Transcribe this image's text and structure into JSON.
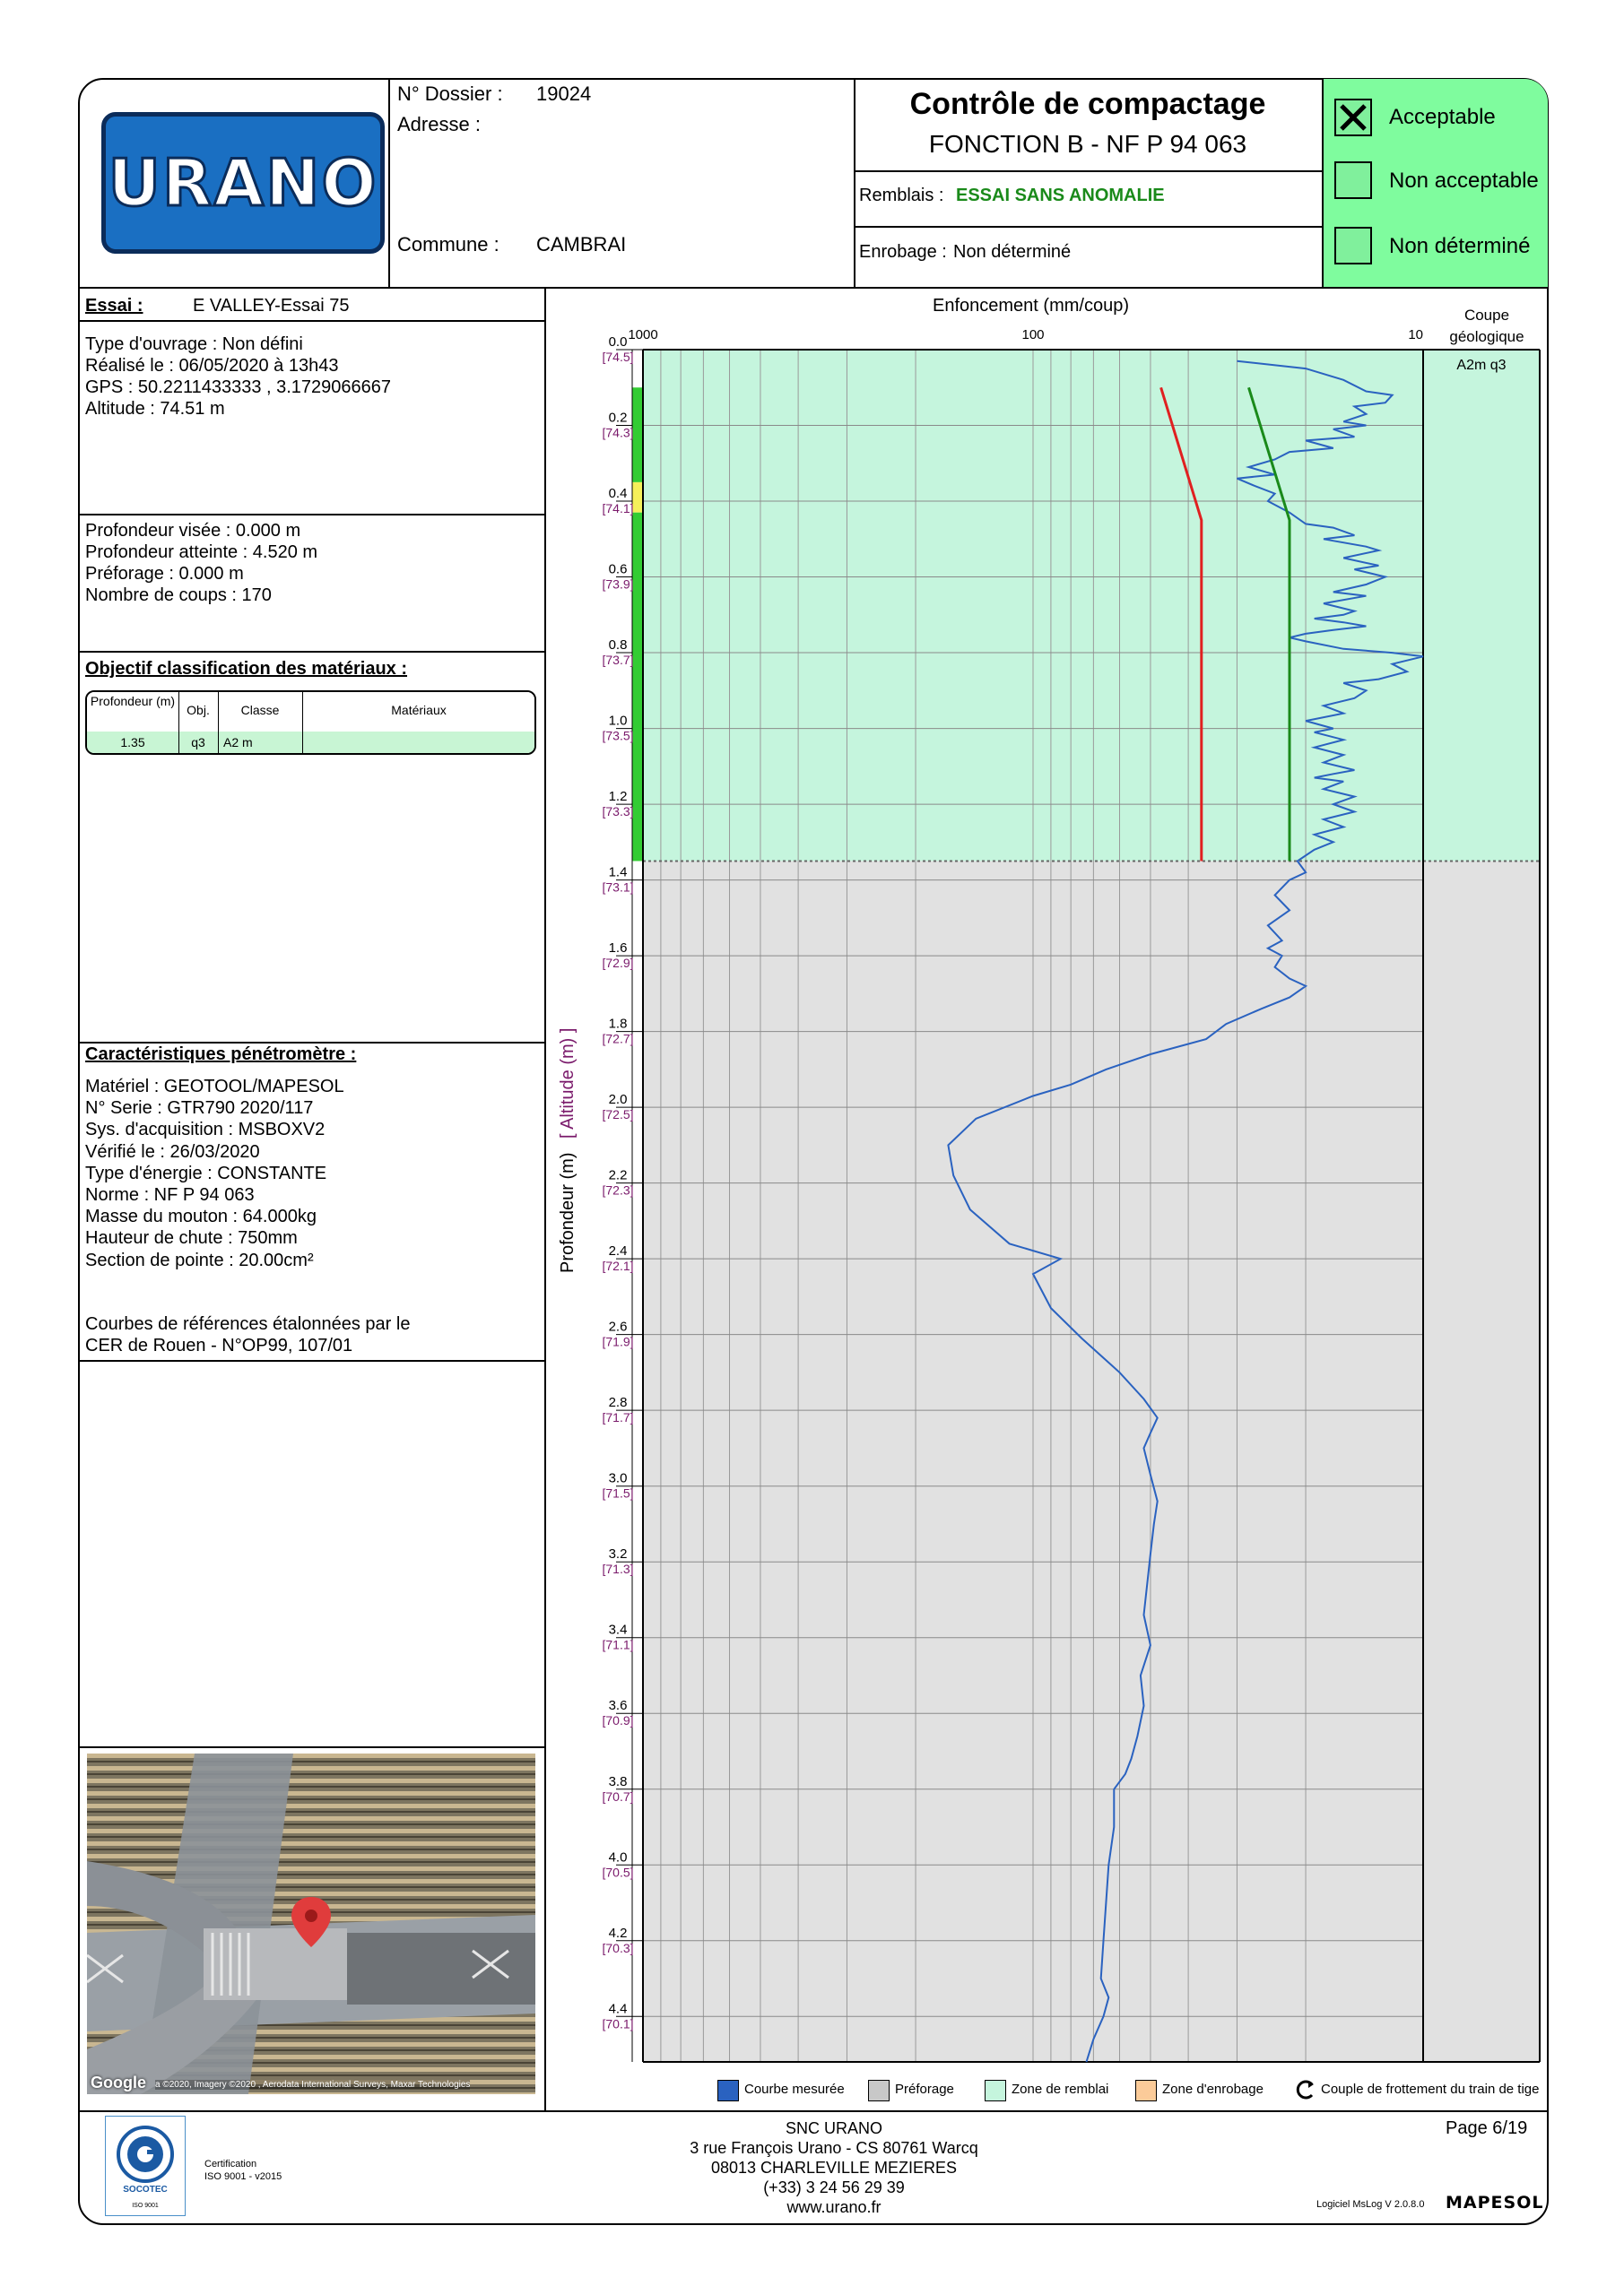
{
  "header": {
    "logo_text": "URANO",
    "dossier_label": "N° Dossier :",
    "dossier_value": "19024",
    "adresse_label": "Adresse :",
    "commune_label": "Commune :",
    "commune_value": "CAMBRAI",
    "title": "Contrôle de compactage",
    "subtitle": "FONCTION B - NF P 94 063",
    "remblais_label": "Remblais :",
    "remblais_value": "ESSAI SANS ANOMALIE",
    "enrobage_label": "Enrobage :",
    "enrobage_value": "Non déterminé",
    "status": [
      {
        "label": "Acceptable",
        "checked": true
      },
      {
        "label": "Non acceptable",
        "checked": false
      },
      {
        "label": "Non déterminé",
        "checked": false
      }
    ],
    "status_color": "#7ffc9e"
  },
  "essai": {
    "label": "Essai :",
    "value": "E VALLEY-Essai 75",
    "info": [
      "Type d'ouvrage : Non défini",
      "Réalisé le  : 06/05/2020  à 13h43",
      "GPS : 50.2211433333 , 3.1729066667",
      "Altitude : 74.51 m"
    ],
    "profondeur": [
      "Profondeur visée : 0.000 m",
      "Profondeur atteinte : 4.520 m",
      "Préforage : 0.000 m",
      "Nombre de coups : 170"
    ]
  },
  "objectif": {
    "title": "Objectif classification des matériaux :",
    "columns": [
      "Profondeur (m)",
      "Obj.",
      "Classe",
      "Matériaux"
    ],
    "rows": [
      [
        "1.35",
        "q3",
        "A2 m",
        ""
      ]
    ]
  },
  "penetrometre": {
    "title": "Caractéristiques pénétromètre :",
    "lines": [
      "Matériel : GEOTOOL/MAPESOL",
      "N° Serie : GTR790 2020/117",
      "Sys. d'acquisition : MSBOXV2",
      "Vérifié le : 26/03/2020",
      "Type d'énergie : CONSTANTE",
      "Norme : NF P 94 063",
      "Masse du mouton : 64.000kg",
      "Hauteur de chute : 750mm",
      "Section de pointe : 20.00cm²"
    ],
    "reference": [
      "Courbes de références étalonnées par le",
      "CER de Rouen - N°OP99, 107/01"
    ]
  },
  "map": {
    "google_label": "Google",
    "credit": "a ©2020, Imagery ©2020 , Aerodata International Surveys, Maxar Technologies"
  },
  "chart_data": {
    "type": "line",
    "title": "Enfoncement (mm/coup)",
    "ylabel": "Profondeur (m)",
    "ylabel2": "[ Altitude (m) ]",
    "xscale": "log",
    "xlim": [
      1000,
      10
    ],
    "xticks": [
      "1000",
      "100",
      "10"
    ],
    "ylim": [
      0,
      4.52
    ],
    "yticks": [
      {
        "depth": "0.0",
        "alt": "[74.5]"
      },
      {
        "depth": "0.2",
        "alt": "[74.3]"
      },
      {
        "depth": "0.4",
        "alt": "[74.1]"
      },
      {
        "depth": "0.6",
        "alt": "[73.9]"
      },
      {
        "depth": "0.8",
        "alt": "[73.7]"
      },
      {
        "depth": "1.0",
        "alt": "[73.5]"
      },
      {
        "depth": "1.2",
        "alt": "[73.3]"
      },
      {
        "depth": "1.4",
        "alt": "[73.1]"
      },
      {
        "depth": "1.6",
        "alt": "[72.9]"
      },
      {
        "depth": "1.8",
        "alt": "[72.7]"
      },
      {
        "depth": "2.0",
        "alt": "[72.5]"
      },
      {
        "depth": "2.2",
        "alt": "[72.3]"
      },
      {
        "depth": "2.4",
        "alt": "[72.1]"
      },
      {
        "depth": "2.6",
        "alt": "[71.9]"
      },
      {
        "depth": "2.8",
        "alt": "[71.7]"
      },
      {
        "depth": "3.0",
        "alt": "[71.5]"
      },
      {
        "depth": "3.2",
        "alt": "[71.3]"
      },
      {
        "depth": "3.4",
        "alt": "[71.1]"
      },
      {
        "depth": "3.6",
        "alt": "[70.9]"
      },
      {
        "depth": "3.8",
        "alt": "[70.7]"
      },
      {
        "depth": "4.0",
        "alt": "[70.5]"
      },
      {
        "depth": "4.2",
        "alt": "[70.3]"
      },
      {
        "depth": "4.4",
        "alt": "[70.1]"
      }
    ],
    "remblai_depth": 1.35,
    "geo_column_label": "Coupe géologique",
    "geo_layer": "A2m q3",
    "series": [
      {
        "name": "Courbe mesurée",
        "color": "#2a62c0",
        "points": [
          [
            30,
            0.03
          ],
          [
            20,
            0.05
          ],
          [
            16,
            0.08
          ],
          [
            14,
            0.11
          ],
          [
            12,
            0.12
          ],
          [
            12.5,
            0.14
          ],
          [
            15,
            0.15
          ],
          [
            14,
            0.17
          ],
          [
            16,
            0.19
          ],
          [
            14,
            0.2
          ],
          [
            17,
            0.21
          ],
          [
            15,
            0.23
          ],
          [
            20,
            0.24
          ],
          [
            17,
            0.26
          ],
          [
            22,
            0.27
          ],
          [
            24,
            0.29
          ],
          [
            28,
            0.31
          ],
          [
            24,
            0.33
          ],
          [
            30,
            0.34
          ],
          [
            27,
            0.36
          ],
          [
            24,
            0.38
          ],
          [
            25,
            0.4
          ],
          [
            22,
            0.43
          ],
          [
            20,
            0.46
          ],
          [
            17,
            0.47
          ],
          [
            15,
            0.49
          ],
          [
            18,
            0.5
          ],
          [
            14,
            0.52
          ],
          [
            13,
            0.53
          ],
          [
            16,
            0.55
          ],
          [
            13,
            0.57
          ],
          [
            15,
            0.58
          ],
          [
            12.5,
            0.6
          ],
          [
            14,
            0.62
          ],
          [
            17,
            0.64
          ],
          [
            14,
            0.65
          ],
          [
            18,
            0.67
          ],
          [
            15,
            0.69
          ],
          [
            16,
            0.7
          ],
          [
            19,
            0.71
          ],
          [
            16,
            0.72
          ],
          [
            14,
            0.73
          ],
          [
            17,
            0.74
          ],
          [
            20,
            0.75
          ],
          [
            22,
            0.76
          ],
          [
            20,
            0.77
          ],
          [
            16,
            0.79
          ],
          [
            12,
            0.8
          ],
          [
            10,
            0.81
          ],
          [
            12,
            0.83
          ],
          [
            11,
            0.85
          ],
          [
            13,
            0.87
          ],
          [
            16,
            0.88
          ],
          [
            14,
            0.9
          ],
          [
            15,
            0.92
          ],
          [
            18,
            0.94
          ],
          [
            16,
            0.96
          ],
          [
            20,
            0.98
          ],
          [
            17,
            1.0
          ],
          [
            19,
            1.01
          ],
          [
            16,
            1.03
          ],
          [
            19,
            1.05
          ],
          [
            16,
            1.07
          ],
          [
            18,
            1.09
          ],
          [
            15,
            1.11
          ],
          [
            17,
            1.12
          ],
          [
            19,
            1.13
          ],
          [
            16,
            1.14
          ],
          [
            18,
            1.16
          ],
          [
            15,
            1.18
          ],
          [
            17,
            1.2
          ],
          [
            15,
            1.22
          ],
          [
            18,
            1.24
          ],
          [
            16,
            1.26
          ],
          [
            19,
            1.28
          ],
          [
            17,
            1.3
          ],
          [
            19,
            1.32
          ],
          [
            21,
            1.35
          ],
          [
            20,
            1.38
          ],
          [
            22,
            1.4
          ],
          [
            24,
            1.44
          ],
          [
            22,
            1.48
          ],
          [
            25,
            1.52
          ],
          [
            23,
            1.56
          ],
          [
            25,
            1.58
          ],
          [
            23,
            1.6
          ],
          [
            24,
            1.63
          ],
          [
            22,
            1.66
          ],
          [
            20,
            1.68
          ],
          [
            22,
            1.71
          ],
          [
            26,
            1.74
          ],
          [
            32,
            1.78
          ],
          [
            36,
            1.82
          ],
          [
            50,
            1.86
          ],
          [
            65,
            1.9
          ],
          [
            80,
            1.94
          ],
          [
            100,
            1.97
          ],
          [
            140,
            2.03
          ],
          [
            165,
            2.1
          ],
          [
            160,
            2.18
          ],
          [
            145,
            2.27
          ],
          [
            115,
            2.36
          ],
          [
            85,
            2.4
          ],
          [
            100,
            2.44
          ],
          [
            90,
            2.53
          ],
          [
            75,
            2.61
          ],
          [
            60,
            2.7
          ],
          [
            52,
            2.77
          ],
          [
            48,
            2.82
          ],
          [
            50,
            2.86
          ],
          [
            52,
            2.9
          ],
          [
            50,
            2.97
          ],
          [
            48,
            3.04
          ],
          [
            49,
            3.1
          ],
          [
            50,
            3.18
          ],
          [
            51,
            3.26
          ],
          [
            52,
            3.34
          ],
          [
            50,
            3.42
          ],
          [
            53,
            3.5
          ],
          [
            52,
            3.58
          ],
          [
            54,
            3.66
          ],
          [
            56,
            3.72
          ],
          [
            58,
            3.76
          ],
          [
            62,
            3.8
          ],
          [
            62,
            3.9
          ],
          [
            64,
            4.0
          ],
          [
            65,
            4.1
          ],
          [
            66,
            4.2
          ],
          [
            67,
            4.3
          ],
          [
            64,
            4.35
          ],
          [
            66,
            4.4
          ],
          [
            70,
            4.46
          ],
          [
            73,
            4.52
          ]
        ]
      },
      {
        "name": "ref-red",
        "color": "#e02020",
        "points": [
          [
            47,
            0.1
          ],
          [
            37,
            0.45
          ],
          [
            37,
            1.35
          ]
        ]
      },
      {
        "name": "ref-green",
        "color": "#1a8a1a",
        "points": [
          [
            28,
            0.1
          ],
          [
            22,
            0.45
          ],
          [
            22,
            1.35
          ]
        ]
      }
    ],
    "depth_bar": [
      {
        "from": 0.1,
        "to": 0.35,
        "color": "#33cc33"
      },
      {
        "from": 0.35,
        "to": 0.43,
        "color": "#f5f05a"
      },
      {
        "from": 0.43,
        "to": 1.35,
        "color": "#33cc33"
      }
    ],
    "legend": [
      {
        "label": "Courbe mesurée",
        "color": "#2a62c0"
      },
      {
        "label": "Préforage",
        "color": "#c8c8c8"
      },
      {
        "label": "Zone de remblai",
        "color": "#c5f5dd"
      },
      {
        "label": "Zone d'enrobage",
        "color": "#fbcb99"
      },
      {
        "label": "Couple de frottement du train de tige",
        "color": ""
      }
    ]
  },
  "footer": {
    "cert_label": "Certification",
    "cert_value": "ISO 9001 - v2015",
    "socotec": "SOCOTEC",
    "iso": "ISO 9001",
    "company": "SNC URANO",
    "address1": "3 rue François Urano - CS 80761 Warcq",
    "address2": "08013 CHARLEVILLE MEZIERES",
    "phone": "(+33) 3 24 56 29 39",
    "website": "www.urano.fr",
    "page": "Page 6/19",
    "software": "Logiciel MsLog V 2.0.8.0",
    "brand": "MAPESOL"
  }
}
